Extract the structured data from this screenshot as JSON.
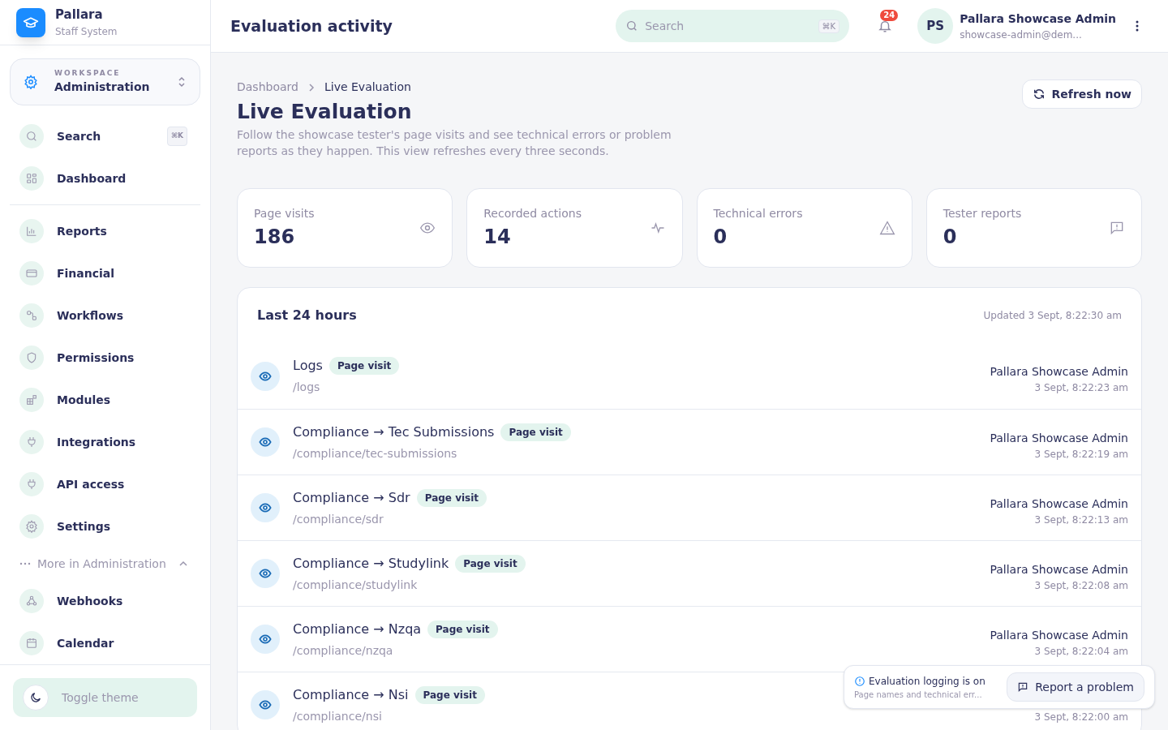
{
  "brand": {
    "name": "Pallara",
    "subtitle": "Staff System"
  },
  "workspace": {
    "label": "WORKSPACE",
    "name": "Administration"
  },
  "sidebar": {
    "search": {
      "label": "Search",
      "shortcut": "⌘K"
    },
    "top_items": [
      {
        "label": "Dashboard",
        "selected": false
      }
    ],
    "items": [
      {
        "label": "Reports",
        "selected": false
      },
      {
        "label": "Financial",
        "selected": false
      },
      {
        "label": "Workflows",
        "selected": false
      },
      {
        "label": "Permissions",
        "selected": false
      },
      {
        "label": "Modules",
        "selected": false
      },
      {
        "label": "Integrations",
        "selected": false
      },
      {
        "label": "API access",
        "selected": false
      },
      {
        "label": "Settings",
        "selected": false
      }
    ],
    "more": {
      "label": "More in Administration",
      "expanded": true
    },
    "more_items": [
      {
        "label": "Webhooks",
        "selected": false
      },
      {
        "label": "Calendar",
        "selected": false
      }
    ],
    "toggle_theme": "Toggle theme"
  },
  "header": {
    "title": "Evaluation activity",
    "search_placeholder": "Search",
    "search_shortcut": "⌘K",
    "notifications": "24",
    "user": {
      "initials": "PS",
      "name": "Pallara Showcase Admin",
      "email": "showcase-admin@dem..."
    }
  },
  "breadcrumbs": [
    "Dashboard",
    "Live Evaluation"
  ],
  "page": {
    "title": "Live Evaluation",
    "description": "Follow the showcase tester's page visits and see technical errors or problem reports as they happen. This view refreshes every three seconds.",
    "refresh": "Refresh now"
  },
  "stats": [
    {
      "label": "Page visits",
      "value": "186",
      "kind": "eye"
    },
    {
      "label": "Recorded actions",
      "value": "14",
      "kind": "pulse"
    },
    {
      "label": "Technical errors",
      "value": "0",
      "kind": "warning"
    },
    {
      "label": "Tester reports",
      "value": "0",
      "kind": "report"
    }
  ],
  "activity": {
    "title": "Last 24 hours",
    "updated": "Updated 3 Sept, 8:22:30 am",
    "rows": [
      {
        "title": "Logs",
        "tag": "Page visit",
        "path": "/logs",
        "user": "Pallara Showcase Admin",
        "time": "3 Sept, 8:22:23 am"
      },
      {
        "title": "Compliance → Tec Submissions",
        "tag": "Page visit",
        "path": "/compliance/tec-submissions",
        "user": "Pallara Showcase Admin",
        "time": "3 Sept, 8:22:19 am"
      },
      {
        "title": "Compliance → Sdr",
        "tag": "Page visit",
        "path": "/compliance/sdr",
        "user": "Pallara Showcase Admin",
        "time": "3 Sept, 8:22:13 am"
      },
      {
        "title": "Compliance → Studylink",
        "tag": "Page visit",
        "path": "/compliance/studylink",
        "user": "Pallara Showcase Admin",
        "time": "3 Sept, 8:22:08 am"
      },
      {
        "title": "Compliance → Nzqa",
        "tag": "Page visit",
        "path": "/compliance/nzqa",
        "user": "Pallara Showcase Admin",
        "time": "3 Sept, 8:22:04 am"
      },
      {
        "title": "Compliance → Nsi",
        "tag": "Page visit",
        "path": "/compliance/nsi",
        "time": "3 Sept, 8:22:00 am"
      }
    ]
  },
  "toast": {
    "title": "Evaluation logging is on",
    "text": "Page names and technical err...",
    "button": "Report a problem"
  }
}
